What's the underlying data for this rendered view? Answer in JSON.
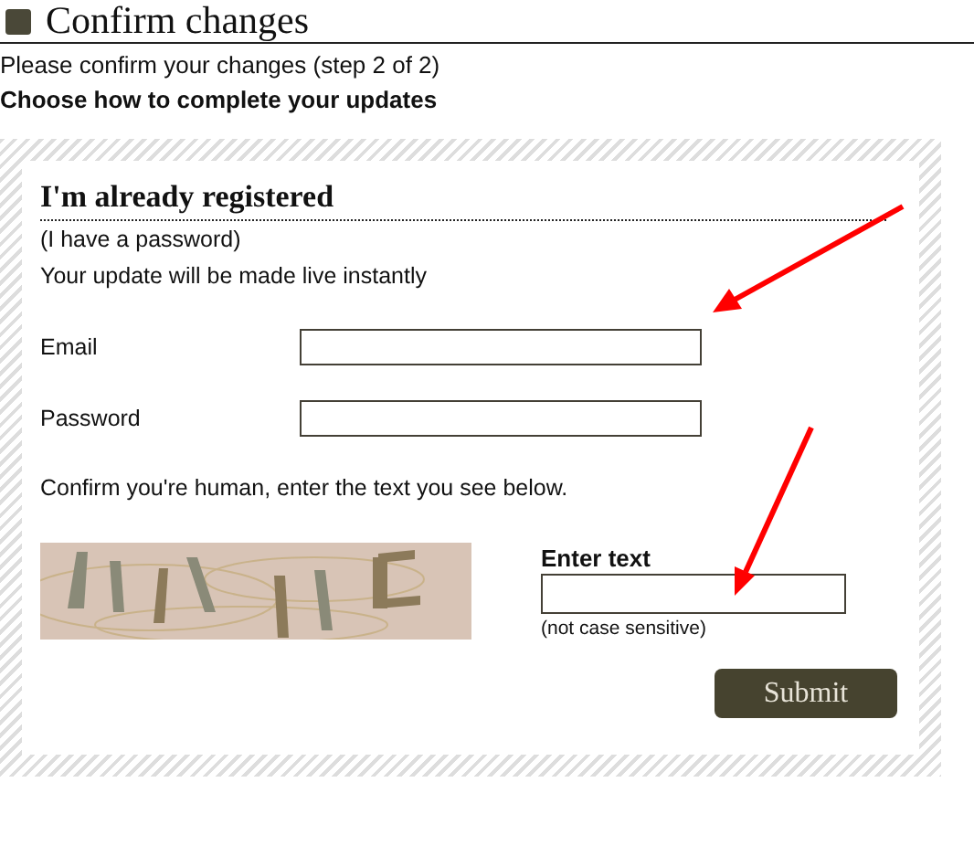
{
  "page_title": "Confirm changes",
  "intro": "Please confirm your changes (step 2 of 2)",
  "subtitle": "Choose how to complete your updates",
  "panel": {
    "heading": "I'm already registered",
    "note": "(I have a password)",
    "info": "Your update will be made live instantly",
    "fields": [
      {
        "label": "Email"
      },
      {
        "label": "Password"
      }
    ],
    "captcha_prompt": "Confirm you're human, enter the text you see below.",
    "captcha_label": "Enter text",
    "captcha_hint": "(not case sensitive)",
    "submit": "Submit"
  }
}
